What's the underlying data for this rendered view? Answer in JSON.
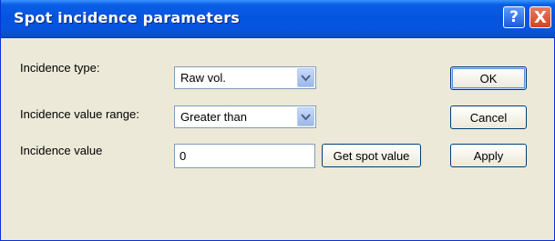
{
  "window": {
    "title": "Spot incidence parameters",
    "help_label": "?",
    "close_label": "X"
  },
  "form": {
    "type_label": "Incidence type:",
    "type_value": "Raw vol.",
    "range_label": "Incidence value range:",
    "range_value": "Greater than",
    "value_label": "Incidence value",
    "value": "0",
    "get_spot_label": "Get spot value"
  },
  "buttons": {
    "ok": "OK",
    "cancel": "Cancel",
    "apply": "Apply"
  },
  "colors": {
    "titlebar": "#0554e0",
    "face": "#ece9d8",
    "close": "#d2431f"
  },
  "icons": [
    "chevron-down-icon",
    "help-icon",
    "close-icon"
  ]
}
